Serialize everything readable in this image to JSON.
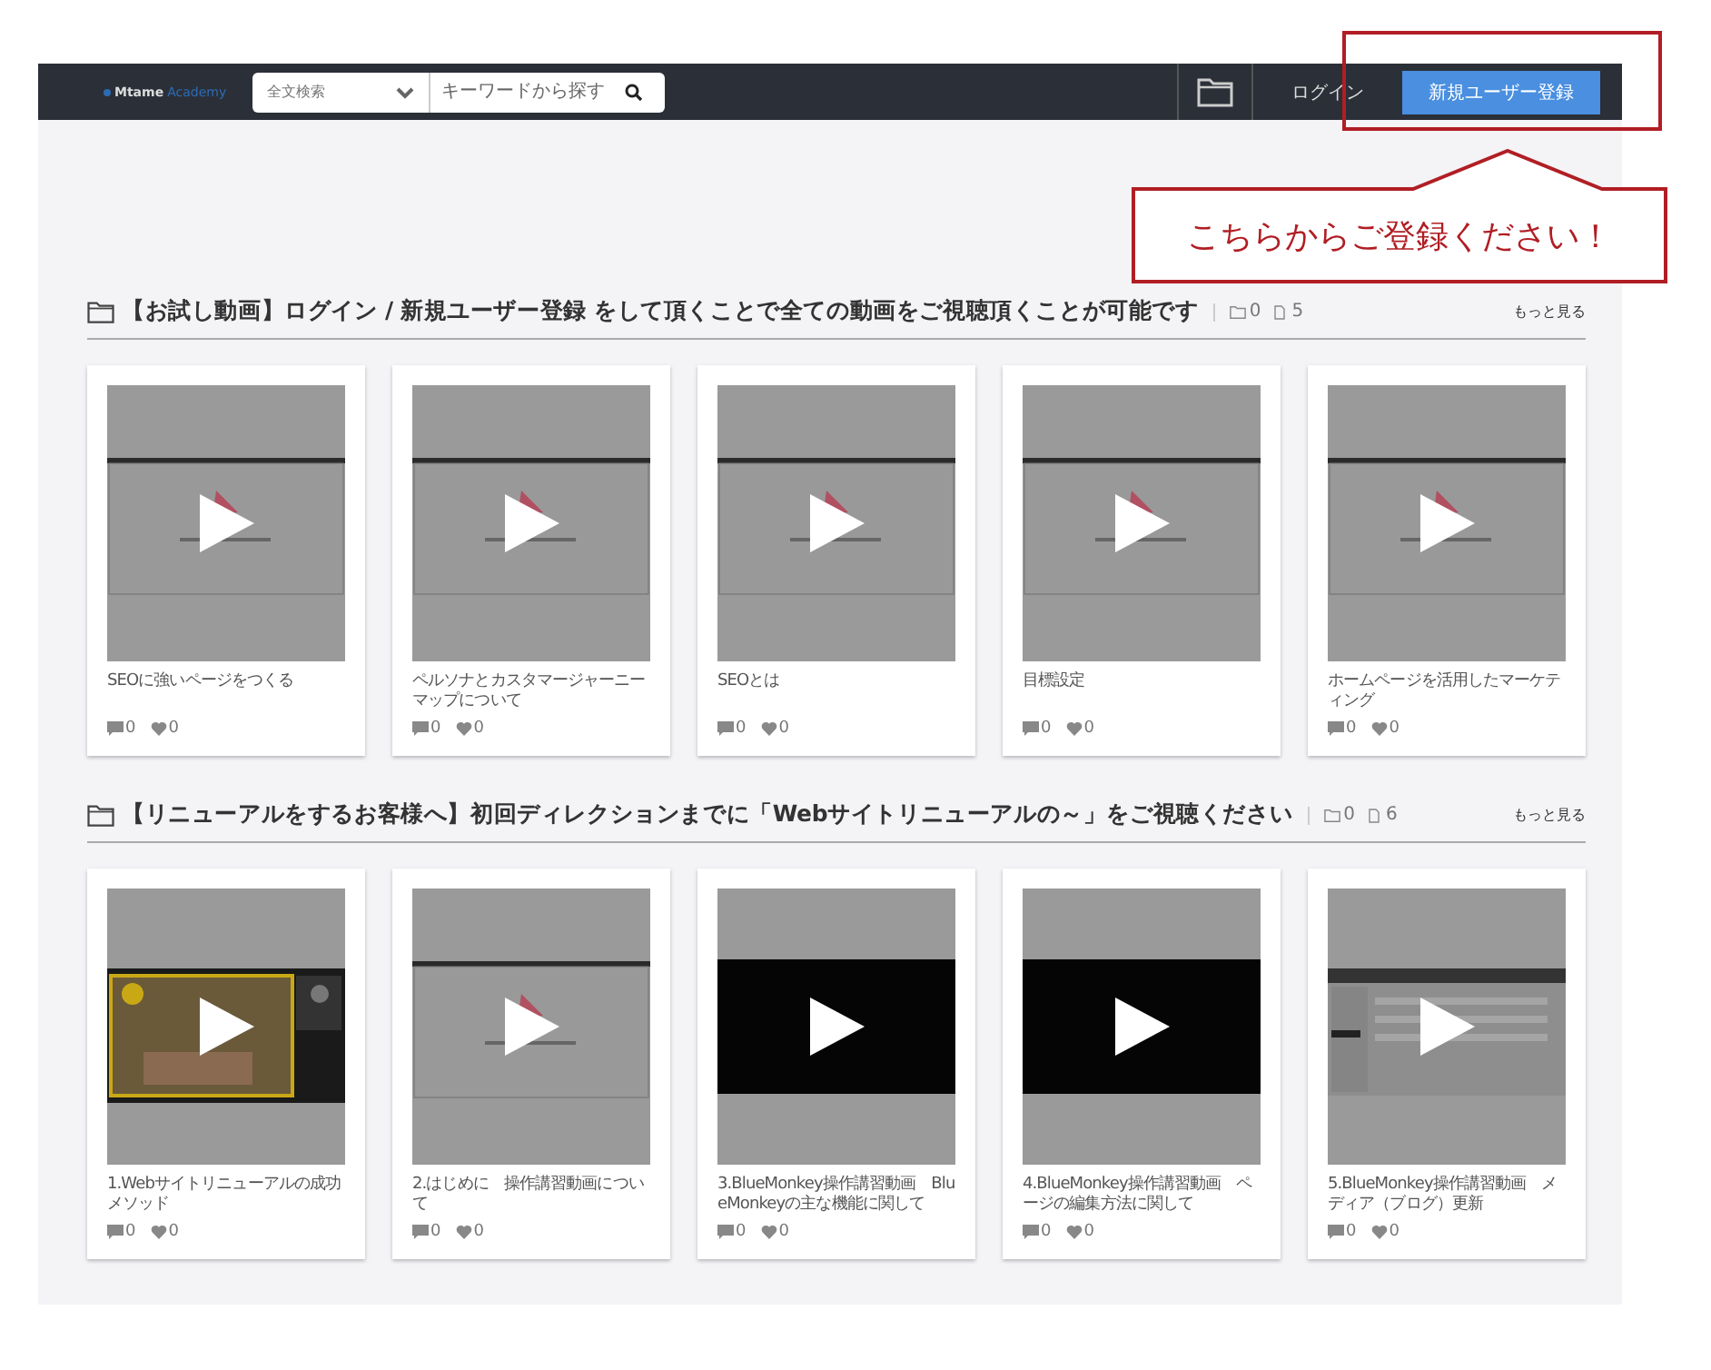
{
  "header": {
    "logo": {
      "brand": "Mtame",
      "suffix": "Academy"
    },
    "search": {
      "scope": "全文検索",
      "placeholder": "キーワードから探す"
    },
    "login": "ログイン",
    "register": "新規ユーザー登録"
  },
  "annotation": {
    "callout": "こちらからご登録ください！"
  },
  "sections": [
    {
      "title": "【お試し動画】ログイン / 新規ユーザー登録 をして頂くことで全ての動画をご視聴頂くことが可能です",
      "folders": "0",
      "videos": "5",
      "more": "もっと見る",
      "items": [
        {
          "title": "SEOに強いページをつくる",
          "comments": "0",
          "likes": "0"
        },
        {
          "title": "ペルソナとカスタマージャーニーマップについて",
          "comments": "0",
          "likes": "0"
        },
        {
          "title": "SEOとは",
          "comments": "0",
          "likes": "0"
        },
        {
          "title": "目標設定",
          "comments": "0",
          "likes": "0"
        },
        {
          "title": "ホームページを活用したマーケティング",
          "comments": "0",
          "likes": "0"
        }
      ]
    },
    {
      "title": "【リニューアルをするお客様へ】初回ディレクションまでに「Webサイトリニューアルの～」をご視聴ください",
      "folders": "0",
      "videos": "6",
      "more": "もっと見る",
      "items": [
        {
          "title": "1.Webサイトリニューアルの成功メソッド",
          "comments": "0",
          "likes": "0"
        },
        {
          "title": "2.はじめに　操作講習動画について",
          "comments": "0",
          "likes": "0"
        },
        {
          "title": "3.BlueMonkey操作講習動画　BlueMonkeyの主な機能に関して",
          "comments": "0",
          "likes": "0"
        },
        {
          "title": "4.BlueMonkey操作講習動画　ページの編集方法に関して",
          "comments": "0",
          "likes": "0"
        },
        {
          "title": "5.BlueMonkey操作講習動画　メディア（ブログ）更新",
          "comments": "0",
          "likes": "0"
        }
      ]
    }
  ]
}
